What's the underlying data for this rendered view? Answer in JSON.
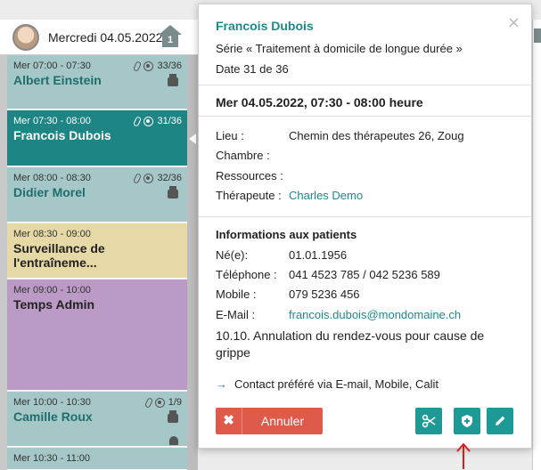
{
  "calendar": {
    "column_date": "Mercredi 04.05.2022",
    "column_badge": "1",
    "events": [
      {
        "time": "Mer 07:00 - 07:30",
        "name": "Albert Einstein",
        "count": "33/36",
        "style": "teal-light"
      },
      {
        "time": "Mer 07:30 - 08:00",
        "name": "Francois Dubois",
        "count": "31/36",
        "style": "teal-dark"
      },
      {
        "time": "Mer 08:00 - 08:30",
        "name": "Didier Morel",
        "count": "32/36",
        "style": "teal-light"
      },
      {
        "time": "Mer 08:30 - 09:00",
        "name": "Surveillance de l'entraîneme...",
        "count": "",
        "style": "yellow"
      },
      {
        "time": "Mer 09:00 - 10:00",
        "name": "Temps Admin",
        "count": "",
        "style": "purple"
      },
      {
        "time": "Mer 10:00 - 10:30",
        "name": "Camille Roux",
        "count": "1/9",
        "style": "teal-light"
      },
      {
        "time": "Mer 10:30 - 11:00",
        "name": "",
        "count": "",
        "style": "teal-light"
      }
    ],
    "next_column_time": "Mer 10:30 - 11:00"
  },
  "popup": {
    "patient_name": "Francois Dubois",
    "series": "Série « Traitement à domicile de longue durée »",
    "date_of": "Date 31 de 36",
    "when": "Mer 04.05.2022, 07:30 - 08:00 heure",
    "details": {
      "lieu_label": "Lieu :",
      "lieu_value": "Chemin des thérapeutes 26, Zoug",
      "chambre_label": "Chambre :",
      "ressources_label": "Ressources :",
      "therapeute_label": "Thérapeute :",
      "therapeute_value": "Charles Demo"
    },
    "patient_info": {
      "title": "Informations aux patients",
      "born_label": "Né(e):",
      "born_value": "01.01.1956",
      "phone_label": "Téléphone :",
      "phone_value": "041 4523 785 / 042 5236 589",
      "mobile_label": "Mobile :",
      "mobile_value": "079 5236 456",
      "email_label": "E-Mail :",
      "email_value": "francois.dubois@mondomaine.ch",
      "note": "10.10. Annulation du rendez-vous pour cause de grippe",
      "contact": "Contact préféré via E-mail, Mobile, Calit"
    },
    "buttons": {
      "cancel_label": "Annuler"
    },
    "close_symbol": "×"
  },
  "colors": {
    "accent": "#1d8a8a",
    "cancel": "#e05a4b",
    "teal_light": "#a6c7c7",
    "teal_dark": "#1e8585",
    "yellow": "#e6d9a6",
    "purple": "#bb9ac6",
    "annotation": "#d62020"
  }
}
